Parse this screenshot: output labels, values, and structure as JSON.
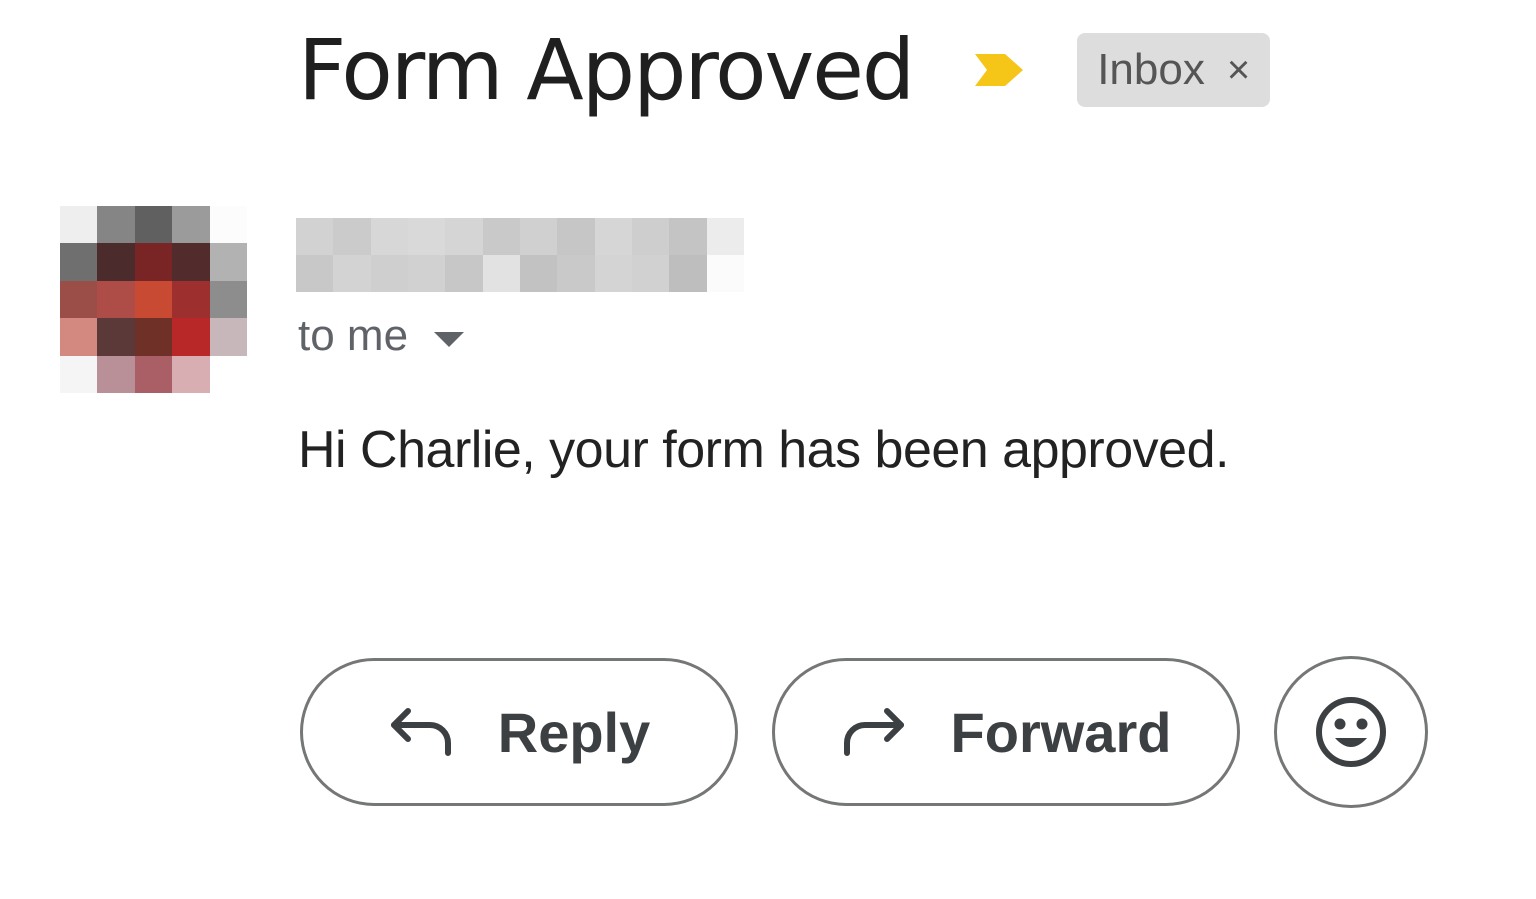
{
  "subject": "Form Approved",
  "importance_marker": {
    "icon": "importance-arrow-icon",
    "color": "#F5C518"
  },
  "labels": [
    {
      "text": "Inbox",
      "remove_symbol": "×"
    }
  ],
  "sender": {
    "avatar_icon": "pixelated-avatar",
    "name_redacted": true
  },
  "recipients": {
    "text": "to me"
  },
  "body": {
    "text": "Hi Charlie, your form has been approved."
  },
  "actions": {
    "reply_label": "Reply",
    "forward_label": "Forward",
    "emoji_icon": "smiley-icon"
  }
}
